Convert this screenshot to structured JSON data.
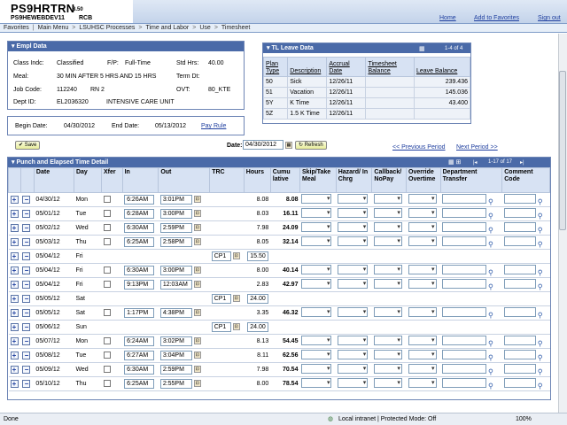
{
  "banner": {
    "logo": "PS9HRTRN",
    "version": "8.50",
    "server": "PS9HEWEBDEV11",
    "user": "RCB",
    "links": [
      "Home",
      "Add to Favorites",
      "Sign out"
    ]
  },
  "menu": {
    "items": [
      "Favorites",
      "Main Menu",
      "LSUHSC Processes",
      "Time and Labor",
      "Use",
      "Timesheet"
    ]
  },
  "empl": {
    "title": "Empl Data",
    "class_label": "Class Indc:",
    "class_value": "Classified",
    "fp_label": "F/P:",
    "fp_value": "Full-Time",
    "std_label": "Std Hrs:",
    "std_value": "40.00",
    "meal_label": "Meal:",
    "meal_value": "30 MIN AFTER 5 HRS AND 15 HRS",
    "term_label": "Term Dt:",
    "job_label": "Job Code:",
    "job_value": "112240",
    "job_desc": "RN 2",
    "ovt_label": "OVT:",
    "ovt_value": "80_KTE",
    "dept_label": "Dept ID:",
    "dept_value": "EL2036320",
    "dept_desc": "INTENSIVE CARE UNIT"
  },
  "dates": {
    "begin_label": "Begin Date:",
    "begin_value": "04/30/2012",
    "end_label": "End Date:",
    "end_value": "05/13/2012",
    "pay_rule": "Pay Rule"
  },
  "leave": {
    "title": "TL Leave Data",
    "pager": "1-4 of 4",
    "headers": [
      "Plan Type",
      "Description",
      "Accrual Date",
      "Timesheet Balance",
      "Leave Balance"
    ],
    "rows": [
      [
        "50",
        "Sick",
        "12/26/11",
        "",
        "239.436"
      ],
      [
        "51",
        "Vacation",
        "12/26/11",
        "",
        "145.036"
      ],
      [
        "5Y",
        "K Time",
        "12/26/11",
        "",
        "43.400"
      ],
      [
        "5Z",
        "1.5 K Time",
        "12/26/11",
        "",
        ""
      ]
    ]
  },
  "toolbar": {
    "save": "Save",
    "date_label": "Date:",
    "date_value": "04/30/2012",
    "refresh": "Refresh",
    "prev": "<< Previous Period",
    "next": "Next Period >>"
  },
  "punch": {
    "title": "Punch and Elapsed Time Detail",
    "pager": "1-17 of 17",
    "headers": [
      "Date",
      "Day",
      "Xfer",
      "In",
      "Out",
      "TRC",
      "Hours",
      "Cumu lative",
      "Skip/Take Meal",
      "Hazard/ In Chrg",
      "Callback/ NoPay",
      "Override Overtime",
      "Department Transfer",
      "Comment Code"
    ],
    "rows": [
      {
        "date": "04/30/12",
        "day": "Mon",
        "in": "6:26AM",
        "out": "3:01PM",
        "trc": "",
        "hours": "8.08",
        "cum": "8.08"
      },
      {
        "date": "05/01/12",
        "day": "Tue",
        "in": "6:28AM",
        "out": "3:00PM",
        "trc": "",
        "hours": "8.03",
        "cum": "16.11"
      },
      {
        "date": "05/02/12",
        "day": "Wed",
        "in": "6:30AM",
        "out": "2:59PM",
        "trc": "",
        "hours": "7.98",
        "cum": "24.09"
      },
      {
        "date": "05/03/12",
        "day": "Thu",
        "in": "6:25AM",
        "out": "2:58PM",
        "trc": "",
        "hours": "8.05",
        "cum": "32.14"
      },
      {
        "date": "05/04/12",
        "day": "Fri",
        "in": "",
        "out": "",
        "trc": "CP1",
        "hours": "15.50",
        "cum": ""
      },
      {
        "date": "05/04/12",
        "day": "Fri",
        "in": "6:30AM",
        "out": "3:00PM",
        "trc": "",
        "hours": "8.00",
        "cum": "40.14"
      },
      {
        "date": "05/04/12",
        "day": "Fri",
        "in": "9:13PM",
        "out": "12:03AM",
        "trc": "",
        "hours": "2.83",
        "cum": "42.97"
      },
      {
        "date": "05/05/12",
        "day": "Sat",
        "in": "",
        "out": "",
        "trc": "CP1",
        "hours": "24.00",
        "cum": ""
      },
      {
        "date": "05/05/12",
        "day": "Sat",
        "in": "1:17PM",
        "out": "4:38PM",
        "trc": "",
        "hours": "3.35",
        "cum": "46.32"
      },
      {
        "date": "05/06/12",
        "day": "Sun",
        "in": "",
        "out": "",
        "trc": "CP1",
        "hours": "24.00",
        "cum": ""
      },
      {
        "date": "05/07/12",
        "day": "Mon",
        "in": "6:24AM",
        "out": "3:02PM",
        "trc": "",
        "hours": "8.13",
        "cum": "54.45"
      },
      {
        "date": "05/08/12",
        "day": "Tue",
        "in": "6:27AM",
        "out": "3:04PM",
        "trc": "",
        "hours": "8.11",
        "cum": "62.56"
      },
      {
        "date": "05/09/12",
        "day": "Wed",
        "in": "6:30AM",
        "out": "2:59PM",
        "trc": "",
        "hours": "7.98",
        "cum": "70.54"
      },
      {
        "date": "05/10/12",
        "day": "Thu",
        "in": "6:25AM",
        "out": "2:55PM",
        "trc": "",
        "hours": "8.00",
        "cum": "78.54"
      }
    ]
  },
  "status": {
    "left": "Done",
    "zone": "Local intranet | Protected Mode: Off",
    "zoom": "100%"
  }
}
